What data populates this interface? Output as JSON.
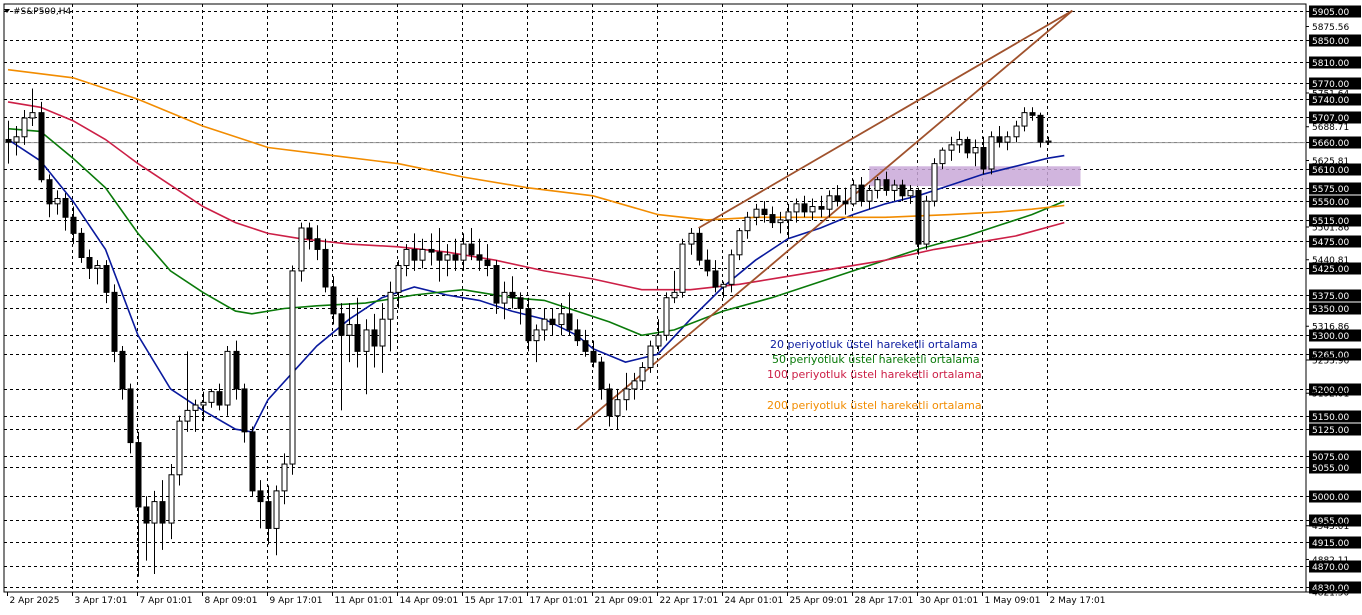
{
  "symbol_label": "#S&P500,H4",
  "chart_data": {
    "type": "candlestick",
    "title": "",
    "ylim": [
      4821.5,
      5917.5
    ],
    "grid": true,
    "colors": {
      "background": "#ffffff",
      "candle_up": "#ffffff",
      "candle_down": "#000000",
      "candle_outline": "#000000",
      "grid": "#000000",
      "ema20": "#0a1a9e",
      "ema50": "#0a7a0a",
      "ema100": "#cc1f46",
      "ema200": "#f28c00",
      "trendline": "#a0522d",
      "zone": "#c9a8d8",
      "price_box": "#000000",
      "price_text": "#ffffff",
      "current_price_line": "#9a9a9a"
    },
    "y_grid_labels": [
      "5905.00",
      "5850.00",
      "5810.00",
      "5770.00",
      "5740.00",
      "5707.00",
      "5660.00",
      "5610.00",
      "5575.00",
      "5550.00",
      "5515.00",
      "5475.00",
      "5425.00",
      "5375.00",
      "5350.00",
      "5300.00",
      "5265.00",
      "5200.00",
      "5150.00",
      "5125.00",
      "5075.00",
      "5055.00",
      "5000.00",
      "4955.00",
      "4915.00",
      "4870.00",
      "4830.00"
    ],
    "y_text_labels": [
      "5875.56",
      "5751.64",
      "5688.71",
      "5625.81",
      "5501.86",
      "5440.81",
      "5316.86",
      "5253.96",
      "5192.01",
      "4945.01",
      "4882.11",
      "4821.50"
    ],
    "current_price": "5660.00",
    "x_labels": [
      "2 Apr 2025",
      "3 Apr 17:01",
      "7 Apr 01:01",
      "8 Apr 09:01",
      "9 Apr 17:01",
      "11 Apr 01:01",
      "14 Apr 09:01",
      "15 Apr 17:01",
      "17 Apr 01:01",
      "21 Apr 09:01",
      "22 Apr 17:01",
      "24 Apr 01:01",
      "25 Apr 09:01",
      "28 Apr 17:01",
      "30 Apr 01:01",
      "1 May 09:01",
      "2 May 17:01"
    ],
    "x_label_index": [
      0,
      8,
      16,
      24,
      32,
      40,
      48,
      56,
      64,
      72,
      80,
      88,
      96,
      104,
      112,
      120,
      128
    ],
    "annotations": [
      {
        "text": "20 periyotluk üstel hareketli ortalama",
        "series": "ema20"
      },
      {
        "text": "50 periyotluk üstel hareketli ortalama",
        "series": "ema50"
      },
      {
        "text": "100 periyotluk üstel hareketli ortalama",
        "series": "ema100"
      },
      {
        "text": "200 periyotluk üstel hareketli ortalama",
        "series": "ema200"
      }
    ],
    "candles": [
      [
        5665,
        5700,
        5620,
        5660
      ],
      [
        5660,
        5690,
        5635,
        5670
      ],
      [
        5670,
        5720,
        5655,
        5705
      ],
      [
        5705,
        5760,
        5690,
        5715
      ],
      [
        5715,
        5735,
        5585,
        5590
      ],
      [
        5590,
        5600,
        5520,
        5545
      ],
      [
        5545,
        5570,
        5525,
        5555
      ],
      [
        5555,
        5565,
        5495,
        5520
      ],
      [
        5520,
        5540,
        5470,
        5490
      ],
      [
        5490,
        5500,
        5435,
        5445
      ],
      [
        5445,
        5460,
        5405,
        5425
      ],
      [
        5425,
        5440,
        5395,
        5430
      ],
      [
        5430,
        5440,
        5360,
        5380
      ],
      [
        5380,
        5395,
        5250,
        5270
      ],
      [
        5270,
        5280,
        5180,
        5200
      ],
      [
        5200,
        5210,
        5080,
        5100
      ],
      [
        5100,
        5120,
        4850,
        4980
      ],
      [
        4980,
        5000,
        4880,
        4950
      ],
      [
        4950,
        5010,
        4855,
        4990
      ],
      [
        4990,
        5030,
        4900,
        4950
      ],
      [
        4950,
        5060,
        4920,
        5040
      ],
      [
        5040,
        5150,
        5020,
        5140
      ],
      [
        5140,
        5270,
        5120,
        5160
      ],
      [
        5160,
        5180,
        5120,
        5170
      ],
      [
        5170,
        5195,
        5140,
        5175
      ],
      [
        5175,
        5200,
        5165,
        5195
      ],
      [
        5195,
        5210,
        5160,
        5170
      ],
      [
        5170,
        5280,
        5150,
        5270
      ],
      [
        5270,
        5290,
        5180,
        5200
      ],
      [
        5200,
        5210,
        5100,
        5120
      ],
      [
        5120,
        5130,
        5000,
        5010
      ],
      [
        5010,
        5030,
        4940,
        4990
      ],
      [
        4990,
        5020,
        4910,
        4940
      ],
      [
        4940,
        5020,
        4890,
        5010
      ],
      [
        5010,
        5080,
        4985,
        5060
      ],
      [
        5060,
        5430,
        5040,
        5420
      ],
      [
        5420,
        5510,
        5400,
        5500
      ],
      [
        5500,
        5510,
        5460,
        5480
      ],
      [
        5480,
        5505,
        5440,
        5460
      ],
      [
        5460,
        5480,
        5380,
        5390
      ],
      [
        5390,
        5410,
        5320,
        5340
      ],
      [
        5340,
        5360,
        5160,
        5300
      ],
      [
        5300,
        5360,
        5250,
        5320
      ],
      [
        5320,
        5370,
        5240,
        5270
      ],
      [
        5270,
        5330,
        5190,
        5310
      ],
      [
        5310,
        5340,
        5240,
        5280
      ],
      [
        5280,
        5360,
        5230,
        5330
      ],
      [
        5330,
        5400,
        5270,
        5380
      ],
      [
        5380,
        5440,
        5350,
        5430
      ],
      [
        5430,
        5470,
        5410,
        5460
      ],
      [
        5460,
        5490,
        5420,
        5440
      ],
      [
        5440,
        5480,
        5425,
        5460
      ],
      [
        5460,
        5490,
        5430,
        5455
      ],
      [
        5455,
        5500,
        5400,
        5440
      ],
      [
        5440,
        5470,
        5410,
        5450
      ],
      [
        5450,
        5480,
        5420,
        5440
      ],
      [
        5440,
        5490,
        5420,
        5470
      ],
      [
        5470,
        5500,
        5440,
        5450
      ],
      [
        5450,
        5480,
        5420,
        5440
      ],
      [
        5440,
        5470,
        5410,
        5430
      ],
      [
        5430,
        5440,
        5340,
        5360
      ],
      [
        5360,
        5400,
        5330,
        5380
      ],
      [
        5380,
        5410,
        5350,
        5370
      ],
      [
        5370,
        5380,
        5320,
        5350
      ],
      [
        5350,
        5370,
        5270,
        5290
      ],
      [
        5290,
        5320,
        5250,
        5310
      ],
      [
        5310,
        5350,
        5290,
        5330
      ],
      [
        5330,
        5350,
        5300,
        5320
      ],
      [
        5320,
        5360,
        5300,
        5340
      ],
      [
        5340,
        5380,
        5300,
        5310
      ],
      [
        5310,
        5330,
        5280,
        5290
      ],
      [
        5290,
        5310,
        5260,
        5270
      ],
      [
        5270,
        5290,
        5240,
        5250
      ],
      [
        5250,
        5260,
        5180,
        5200
      ],
      [
        5200,
        5210,
        5130,
        5150
      ],
      [
        5150,
        5200,
        5125,
        5180
      ],
      [
        5180,
        5230,
        5160,
        5200
      ],
      [
        5200,
        5230,
        5180,
        5215
      ],
      [
        5215,
        5250,
        5200,
        5240
      ],
      [
        5240,
        5290,
        5230,
        5280
      ],
      [
        5280,
        5330,
        5270,
        5300
      ],
      [
        5300,
        5380,
        5290,
        5370
      ],
      [
        5370,
        5420,
        5360,
        5380
      ],
      [
        5380,
        5480,
        5370,
        5470
      ],
      [
        5470,
        5500,
        5450,
        5490
      ],
      [
        5490,
        5500,
        5430,
        5440
      ],
      [
        5440,
        5460,
        5410,
        5420
      ],
      [
        5420,
        5440,
        5380,
        5390
      ],
      [
        5390,
        5400,
        5370,
        5395
      ],
      [
        5395,
        5460,
        5380,
        5450
      ],
      [
        5450,
        5500,
        5440,
        5495
      ],
      [
        5495,
        5530,
        5480,
        5520
      ],
      [
        5520,
        5545,
        5505,
        5535
      ],
      [
        5535,
        5550,
        5510,
        5525
      ],
      [
        5525,
        5540,
        5500,
        5510
      ],
      [
        5510,
        5530,
        5490,
        5515
      ],
      [
        5515,
        5545,
        5480,
        5530
      ],
      [
        5530,
        5555,
        5510,
        5545
      ],
      [
        5545,
        5560,
        5520,
        5530
      ],
      [
        5530,
        5555,
        5515,
        5540
      ],
      [
        5540,
        5560,
        5520,
        5535
      ],
      [
        5535,
        5570,
        5520,
        5560
      ],
      [
        5560,
        5580,
        5540,
        5550
      ],
      [
        5550,
        5575,
        5525,
        5545
      ],
      [
        5545,
        5590,
        5540,
        5580
      ],
      [
        5580,
        5595,
        5540,
        5550
      ],
      [
        5550,
        5580,
        5535,
        5570
      ],
      [
        5570,
        5595,
        5555,
        5590
      ],
      [
        5590,
        5605,
        5560,
        5570
      ],
      [
        5570,
        5590,
        5550,
        5580
      ],
      [
        5580,
        5590,
        5550,
        5560
      ],
      [
        5560,
        5580,
        5545,
        5570
      ],
      [
        5570,
        5575,
        5450,
        5470
      ],
      [
        5470,
        5560,
        5460,
        5550
      ],
      [
        5550,
        5630,
        5540,
        5620
      ],
      [
        5620,
        5650,
        5610,
        5645
      ],
      [
        5645,
        5670,
        5625,
        5655
      ],
      [
        5655,
        5680,
        5640,
        5665
      ],
      [
        5665,
        5670,
        5630,
        5640
      ],
      [
        5640,
        5665,
        5615,
        5650
      ],
      [
        5650,
        5670,
        5600,
        5610
      ],
      [
        5610,
        5680,
        5600,
        5670
      ],
      [
        5670,
        5690,
        5650,
        5660
      ],
      [
        5660,
        5680,
        5645,
        5670
      ],
      [
        5670,
        5700,
        5660,
        5690
      ],
      [
        5690,
        5725,
        5680,
        5715
      ],
      [
        5715,
        5725,
        5700,
        5710
      ],
      [
        5710,
        5715,
        5650,
        5660
      ],
      [
        5660,
        5670,
        5655,
        5662
      ]
    ],
    "series": [
      {
        "key": "ema20",
        "points": [
          [
            0,
            5665
          ],
          [
            4,
            5625
          ],
          [
            8,
            5550
          ],
          [
            12,
            5460
          ],
          [
            16,
            5300
          ],
          [
            20,
            5200
          ],
          [
            24,
            5160
          ],
          [
            28,
            5125
          ],
          [
            30,
            5120
          ],
          [
            32,
            5180
          ],
          [
            35,
            5230
          ],
          [
            38,
            5280
          ],
          [
            42,
            5330
          ],
          [
            46,
            5370
          ],
          [
            50,
            5390
          ],
          [
            54,
            5375
          ],
          [
            58,
            5365
          ],
          [
            62,
            5345
          ],
          [
            66,
            5330
          ],
          [
            70,
            5300
          ],
          [
            72,
            5275
          ],
          [
            76,
            5250
          ],
          [
            80,
            5265
          ],
          [
            84,
            5330
          ],
          [
            88,
            5390
          ],
          [
            92,
            5440
          ],
          [
            96,
            5480
          ],
          [
            100,
            5500
          ],
          [
            104,
            5525
          ],
          [
            108,
            5545
          ],
          [
            112,
            5560
          ],
          [
            116,
            5580
          ],
          [
            120,
            5600
          ],
          [
            124,
            5615
          ],
          [
            128,
            5630
          ],
          [
            130,
            5635
          ]
        ]
      },
      {
        "key": "ema50",
        "points": [
          [
            0,
            5685
          ],
          [
            4,
            5680
          ],
          [
            8,
            5630
          ],
          [
            12,
            5575
          ],
          [
            16,
            5490
          ],
          [
            20,
            5420
          ],
          [
            24,
            5380
          ],
          [
            28,
            5345
          ],
          [
            30,
            5340
          ],
          [
            34,
            5350
          ],
          [
            38,
            5355
          ],
          [
            44,
            5360
          ],
          [
            50,
            5375
          ],
          [
            56,
            5385
          ],
          [
            62,
            5370
          ],
          [
            66,
            5365
          ],
          [
            70,
            5345
          ],
          [
            74,
            5325
          ],
          [
            78,
            5300
          ],
          [
            82,
            5310
          ],
          [
            88,
            5345
          ],
          [
            94,
            5370
          ],
          [
            100,
            5400
          ],
          [
            106,
            5430
          ],
          [
            112,
            5460
          ],
          [
            118,
            5485
          ],
          [
            122,
            5505
          ],
          [
            126,
            5525
          ],
          [
            130,
            5550
          ]
        ]
      },
      {
        "key": "ema100",
        "points": [
          [
            0,
            5735
          ],
          [
            4,
            5725
          ],
          [
            8,
            5700
          ],
          [
            12,
            5665
          ],
          [
            16,
            5620
          ],
          [
            20,
            5580
          ],
          [
            24,
            5540
          ],
          [
            28,
            5510
          ],
          [
            32,
            5490
          ],
          [
            36,
            5480
          ],
          [
            42,
            5470
          ],
          [
            48,
            5465
          ],
          [
            54,
            5455
          ],
          [
            60,
            5440
          ],
          [
            66,
            5420
          ],
          [
            72,
            5405
          ],
          [
            78,
            5385
          ],
          [
            84,
            5385
          ],
          [
            90,
            5395
          ],
          [
            96,
            5410
          ],
          [
            102,
            5425
          ],
          [
            108,
            5440
          ],
          [
            114,
            5460
          ],
          [
            120,
            5475
          ],
          [
            124,
            5485
          ],
          [
            130,
            5510
          ]
        ]
      },
      {
        "key": "ema200",
        "points": [
          [
            0,
            5795
          ],
          [
            8,
            5780
          ],
          [
            16,
            5740
          ],
          [
            24,
            5690
          ],
          [
            32,
            5650
          ],
          [
            40,
            5635
          ],
          [
            48,
            5620
          ],
          [
            56,
            5595
          ],
          [
            64,
            5575
          ],
          [
            72,
            5560
          ],
          [
            80,
            5525
          ],
          [
            86,
            5515
          ],
          [
            92,
            5520
          ],
          [
            100,
            5520
          ],
          [
            108,
            5520
          ],
          [
            116,
            5525
          ],
          [
            122,
            5530
          ],
          [
            126,
            5535
          ],
          [
            130,
            5542
          ]
        ]
      }
    ],
    "trendlines": [
      {
        "from": [
          70,
          5125
        ],
        "to": [
          131,
          5905
        ]
      },
      {
        "from": [
          85,
          5500
        ],
        "to": [
          131,
          5905
        ]
      }
    ],
    "zone": {
      "from": 106,
      "to": 132,
      "low": 5578,
      "high": 5615
    }
  }
}
